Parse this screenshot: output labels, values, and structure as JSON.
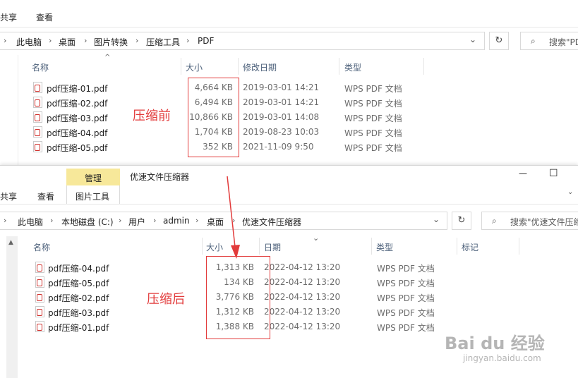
{
  "top_window": {
    "ribbon": {
      "tab_share": "共享",
      "tab_view": "查看"
    },
    "address": {
      "crumbs": [
        "此电脑",
        "桌面",
        "图片转换",
        "压缩工具",
        "PDF"
      ],
      "dropdown_glyph": "⌄",
      "refresh_glyph": "↻"
    },
    "search": {
      "icon_glyph": "⌕",
      "placeholder": "搜索\"PDF"
    },
    "headers": {
      "name": "名称",
      "size": "大小",
      "modified": "修改日期",
      "type": "类型",
      "sort_glyph": "^"
    },
    "files": [
      {
        "name": "pdf压缩-01.pdf",
        "size": "4,664 KB",
        "date": "2019-03-01 14:21",
        "type": "WPS PDF 文档"
      },
      {
        "name": "pdf压缩-02.pdf",
        "size": "6,494 KB",
        "date": "2019-03-01 14:21",
        "type": "WPS PDF 文档"
      },
      {
        "name": "pdf压缩-03.pdf",
        "size": "10,866 KB",
        "date": "2019-03-01 14:08",
        "type": "WPS PDF 文档"
      },
      {
        "name": "pdf压缩-04.pdf",
        "size": "1,704 KB",
        "date": "2019-08-23 10:03",
        "type": "WPS PDF 文档"
      },
      {
        "name": "pdf压缩-05.pdf",
        "size": "352 KB",
        "date": "2021-11-09 9:50",
        "type": "WPS PDF 文档"
      }
    ],
    "annotation": "压缩前"
  },
  "bottom_window": {
    "title": "优速文件压缩器",
    "ribbon": {
      "manage_label": "管理",
      "picture_tools_label": "图片工具",
      "tab_share": "共享",
      "tab_view": "查看"
    },
    "controls": {
      "minimize": "—",
      "maximize": "☐"
    },
    "address": {
      "crumbs": [
        "此电脑",
        "本地磁盘 (C:)",
        "用户",
        "admin",
        "桌面",
        "优速文件压缩器"
      ],
      "dropdown_glyph": "⌄",
      "refresh_glyph": "↻"
    },
    "search": {
      "icon_glyph": "⌕",
      "placeholder": "搜索\"优速文件压缩"
    },
    "headers": {
      "name": "名称",
      "size": "大小",
      "date": "日期",
      "type": "类型",
      "tags": "标记",
      "sort_glyph": "⌄"
    },
    "files": [
      {
        "name": "pdf压缩-04.pdf",
        "size": "1,313 KB",
        "date": "2022-04-12 13:20",
        "type": "WPS PDF 文档"
      },
      {
        "name": "pdf压缩-05.pdf",
        "size": "134 KB",
        "date": "2022-04-12 13:20",
        "type": "WPS PDF 文档"
      },
      {
        "name": "pdf压缩-02.pdf",
        "size": "3,776 KB",
        "date": "2022-04-12 13:20",
        "type": "WPS PDF 文档"
      },
      {
        "name": "pdf压缩-03.pdf",
        "size": "1,312 KB",
        "date": "2022-04-12 13:20",
        "type": "WPS PDF 文档"
      },
      {
        "name": "pdf压缩-01.pdf",
        "size": "1,388 KB",
        "date": "2022-04-12 13:20",
        "type": "WPS PDF 文档"
      }
    ],
    "annotation": "压缩后",
    "scroll_up_glyph": "▲"
  },
  "watermark": {
    "brand": "Bai du 经验",
    "url": "jingyan.baidu.com"
  },
  "colors": {
    "annotation_red": "#e23b3b",
    "manage_tab_yellow": "#f7e89a",
    "header_text": "#4c607a"
  }
}
